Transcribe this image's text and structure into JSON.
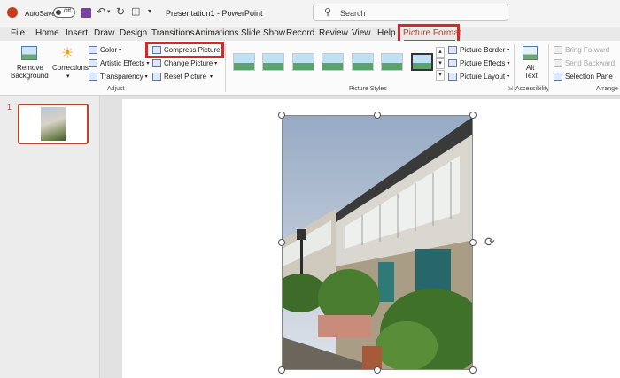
{
  "titlebar": {
    "autosave_label": "AutoSave",
    "autosave_state": "Off",
    "doc_title": "Presentation1  -  PowerPoint",
    "search_placeholder": "Search"
  },
  "tabs": [
    "File",
    "Home",
    "Insert",
    "Draw",
    "Design",
    "Transitions",
    "Animations",
    "Slide Show",
    "Record",
    "Review",
    "View",
    "Help",
    "Picture Format"
  ],
  "active_tab": "Picture Format",
  "ribbon": {
    "remove_bg_line1": "Remove",
    "remove_bg_line2": "Background",
    "corrections": "Corrections",
    "color": "Color",
    "artistic_effects": "Artistic Effects",
    "transparency": "Transparency",
    "compress_pictures": "Compress Pictures",
    "change_picture": "Change Picture",
    "reset_picture": "Reset Picture",
    "adjust_label": "Adjust",
    "picture_border": "Picture Border",
    "picture_effects": "Picture Effects",
    "picture_layout": "Picture Layout",
    "picture_styles_label": "Picture Styles",
    "alt_text_line1": "Alt",
    "alt_text_line2": "Text",
    "accessibility_label": "Accessibility",
    "bring_forward": "Bring Forward",
    "send_backward": "Send Backward",
    "selection_pane": "Selection Pane",
    "arrange_label": "Arrange"
  },
  "slides": {
    "number": "1"
  },
  "colors": {
    "accent": "#b7472a",
    "highlight": "#d62828"
  }
}
